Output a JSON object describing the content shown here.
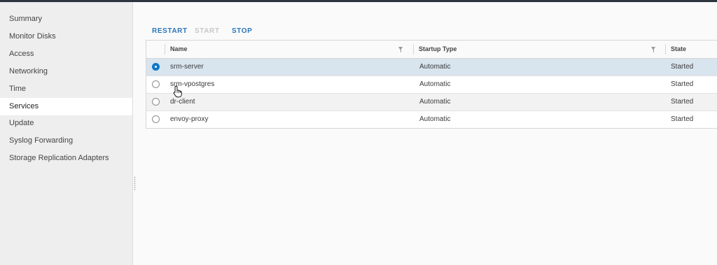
{
  "sidebar": {
    "items": [
      {
        "label": "Summary"
      },
      {
        "label": "Monitor Disks"
      },
      {
        "label": "Access"
      },
      {
        "label": "Networking"
      },
      {
        "label": "Time"
      },
      {
        "label": "Services"
      },
      {
        "label": "Update"
      },
      {
        "label": "Syslog Forwarding"
      },
      {
        "label": "Storage Replication Adapters"
      }
    ],
    "active": "Services"
  },
  "toolbar": {
    "restart_label": "RESTART",
    "start_label": "START",
    "stop_label": "STOP"
  },
  "grid": {
    "columns": {
      "name": "Name",
      "startup_type": "Startup Type",
      "state": "State"
    },
    "rows": [
      {
        "name": "srm-server",
        "startup_type": "Automatic",
        "state": "Started",
        "selected": true
      },
      {
        "name": "srm-vpostgres",
        "startup_type": "Automatic",
        "state": "Started",
        "selected": false
      },
      {
        "name": "dr-client",
        "startup_type": "Automatic",
        "state": "Started",
        "selected": false
      },
      {
        "name": "envoy-proxy",
        "startup_type": "Automatic",
        "state": "Started",
        "selected": false
      }
    ]
  },
  "colors": {
    "accent": "#2b76b8",
    "selected_row": "#d8e4ee",
    "radio_checked": "#0f78c8"
  },
  "icons": {
    "filter": "filter-icon",
    "cursor": "hand-pointer-icon"
  }
}
